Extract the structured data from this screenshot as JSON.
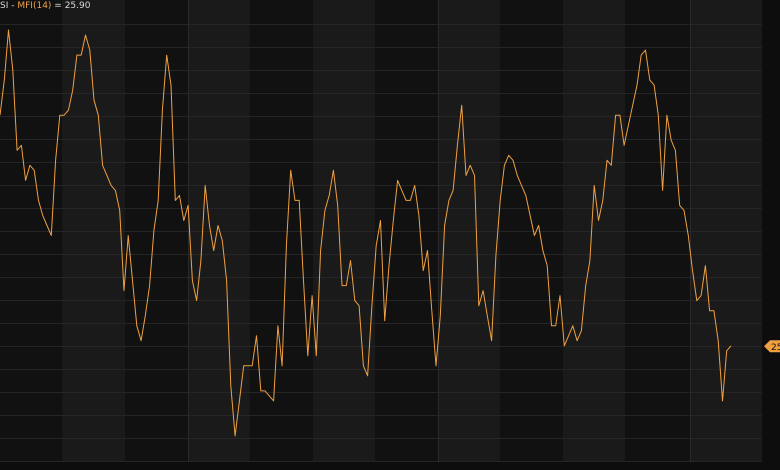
{
  "legend": {
    "prefix": "SI",
    "separator": " - ",
    "series_label": "MFI(14)",
    "equals": " = ",
    "value": "25.90"
  },
  "price_tag": {
    "text": "25"
  },
  "colors": {
    "background": "#0f0f0f",
    "band_dark": "#111111",
    "band_light": "#1a1a1a",
    "grid": "#252525",
    "series": "#f0a040",
    "tag_bg": "#f0a040",
    "tag_text": "#111111"
  },
  "chart_data": {
    "type": "line",
    "grid": true,
    "legend_placement": "top-left",
    "series": [
      {
        "name": "MFI(14)",
        "color": "#f0a040",
        "values": [
          72,
          79,
          89,
          81,
          65,
          66,
          59,
          62,
          61,
          55,
          52,
          50,
          48,
          63,
          72,
          72,
          73,
          77,
          84,
          84,
          88,
          85,
          75,
          72,
          62,
          60,
          58,
          57,
          53,
          37,
          48,
          39,
          30,
          27,
          32,
          38,
          49,
          55,
          73,
          84,
          78,
          55,
          56,
          51,
          54,
          39,
          35,
          43,
          58,
          50,
          45,
          50,
          47,
          39,
          18,
          8,
          15,
          22,
          22,
          22,
          28,
          17,
          17,
          16,
          15,
          30,
          22,
          46,
          61,
          55,
          55,
          39,
          24,
          36,
          24,
          45,
          53,
          56,
          61,
          54,
          38,
          38,
          43,
          35,
          34,
          22,
          20,
          34,
          46,
          51,
          31,
          42,
          51,
          59,
          57,
          55,
          55,
          58,
          52,
          41,
          45,
          33,
          22,
          32,
          50,
          55,
          57,
          66,
          74,
          60,
          62,
          60,
          34,
          37,
          32,
          27,
          44,
          55,
          62,
          64,
          63,
          60,
          58,
          56,
          52,
          48,
          50,
          45,
          42,
          30,
          30,
          36,
          26,
          28,
          30,
          27,
          29,
          38,
          43,
          58,
          51,
          55,
          63,
          62,
          72,
          72,
          66,
          70,
          74,
          78,
          84,
          85,
          79,
          78,
          72,
          57,
          72,
          67,
          65,
          54,
          53,
          48,
          41,
          35,
          36,
          42,
          33,
          33,
          27,
          15,
          25,
          26
        ],
        "current": 25.9
      }
    ]
  }
}
